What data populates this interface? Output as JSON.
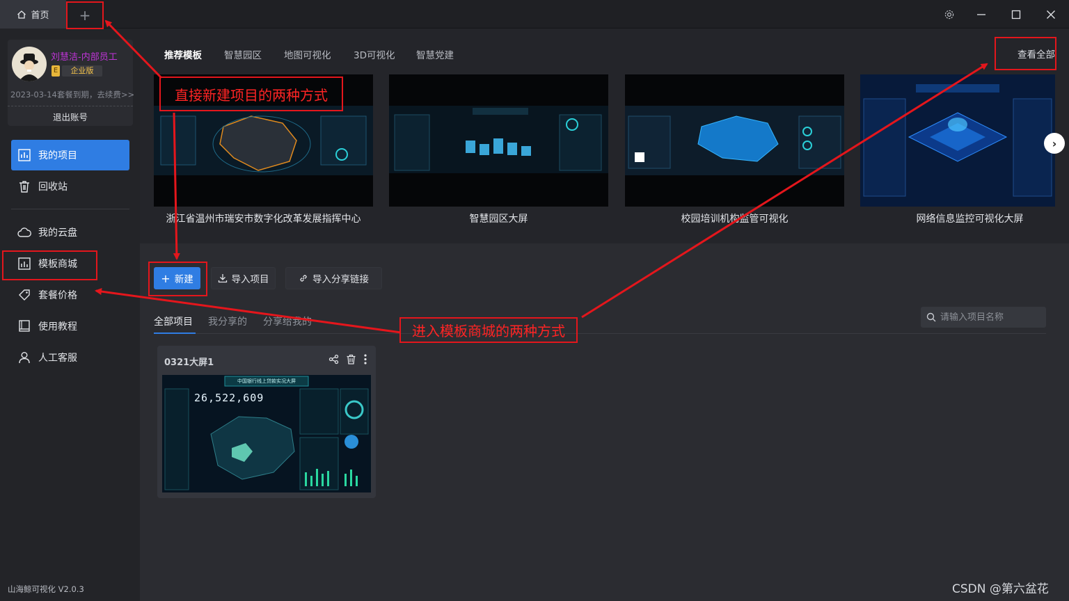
{
  "titlebar": {
    "home_tab": "首页",
    "new_tab": "+"
  },
  "user": {
    "name": "刘慧洁-内部员工",
    "badge_letter": "E",
    "plan": "企业版",
    "expire_notice": "2023-03-14套餐到期，去续费>>",
    "logout": "退出账号"
  },
  "nav": [
    {
      "label": "我的项目",
      "icon": "chart-icon"
    },
    {
      "label": "回收站",
      "icon": "trash-icon"
    },
    {
      "label": "我的云盘",
      "icon": "cloud-icon"
    },
    {
      "label": "模板商城",
      "icon": "template-icon"
    },
    {
      "label": "套餐价格",
      "icon": "tag-icon"
    },
    {
      "label": "使用教程",
      "icon": "book-icon"
    },
    {
      "label": "人工客服",
      "icon": "person-icon"
    }
  ],
  "version": "山海鲸可视化 V2.0.3",
  "templates": {
    "tabs": [
      "推荐模板",
      "智慧园区",
      "地图可视化",
      "3D可视化",
      "智慧党建"
    ],
    "view_all": "查看全部",
    "cards": [
      {
        "title": "浙江省温州市瑞安市数字化改革发展指挥中心"
      },
      {
        "title": "智慧园区大屏"
      },
      {
        "title": "校园培训机构监管可视化"
      },
      {
        "title": "网络信息监控可视化大屏"
      }
    ]
  },
  "toolbar": {
    "new": "新建",
    "import": "导入项目",
    "import_link": "导入分享链接"
  },
  "project_tabs": [
    "全部项目",
    "我分享的",
    "分享给我的"
  ],
  "search": {
    "placeholder": "请输入项目名称"
  },
  "projects": [
    {
      "name": "0321大屏1",
      "thumb_title": "中国银行线上贷款实况大屏",
      "big_number": "26,522,609"
    }
  ],
  "annotations": {
    "new_ways": "直接新建项目的两种方式",
    "store_ways": "进入模板商城的两种方式"
  },
  "watermark": "CSDN @第六盆花"
}
